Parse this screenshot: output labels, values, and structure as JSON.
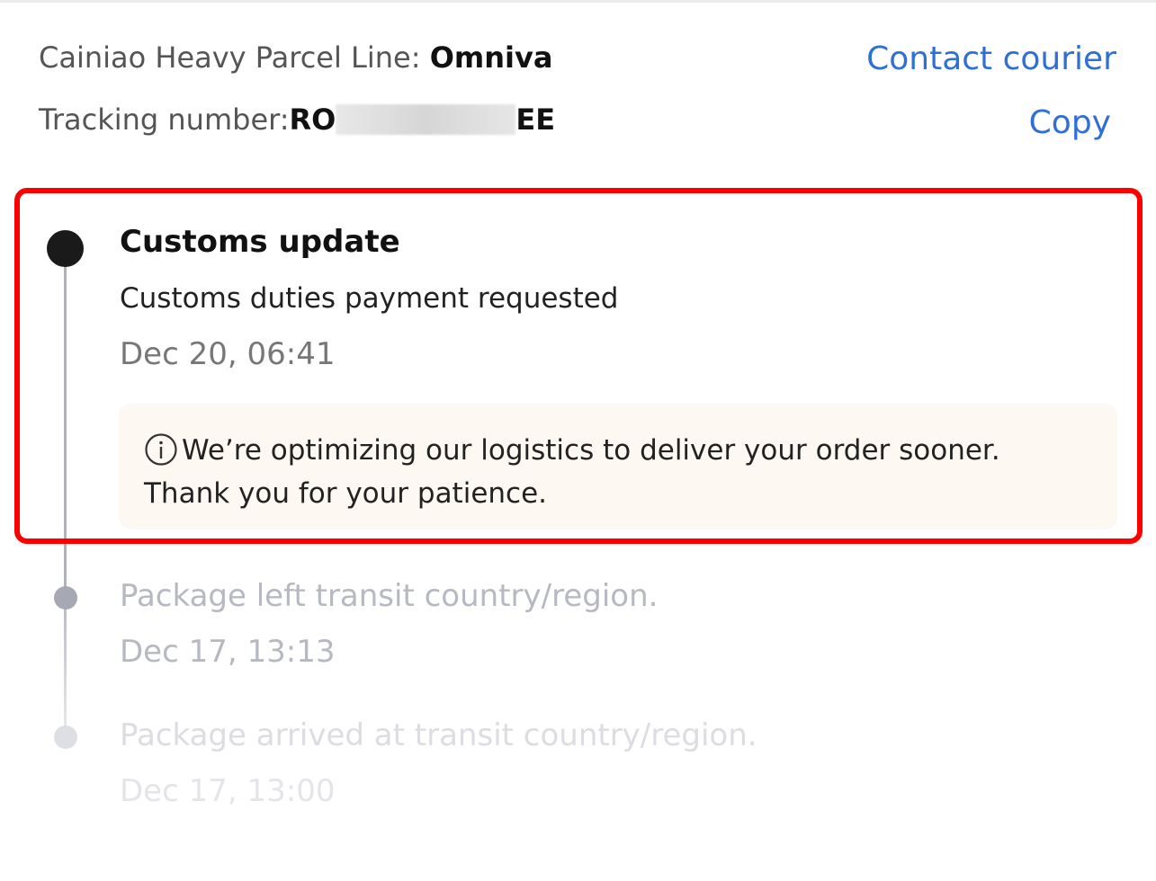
{
  "header": {
    "carrier_prefix": "Cainiao Heavy Parcel Line: ",
    "carrier_name": "Omniva",
    "contact_label": "Contact courier",
    "tracking_prefix": "Tracking number: ",
    "tracking_start": "RO",
    "tracking_end": "EE",
    "copy_label": "Copy"
  },
  "events": [
    {
      "title": "Customs update",
      "description": "Customs duties payment requested",
      "time": "Dec 20, 06:41",
      "notice": "We’re optimizing our logistics to deliver your order sooner. Thank you for your patience."
    },
    {
      "title": "Package left transit country/region.",
      "time": "Dec 17, 13:13"
    },
    {
      "title": "Package arrived at transit country/region.",
      "time": "Dec 17, 13:00"
    }
  ],
  "colors": {
    "link": "#2f6fd8",
    "highlight": "#ff0000",
    "notice_bg": "#fdf8f2"
  },
  "icons": {
    "notice": "info-icon"
  }
}
